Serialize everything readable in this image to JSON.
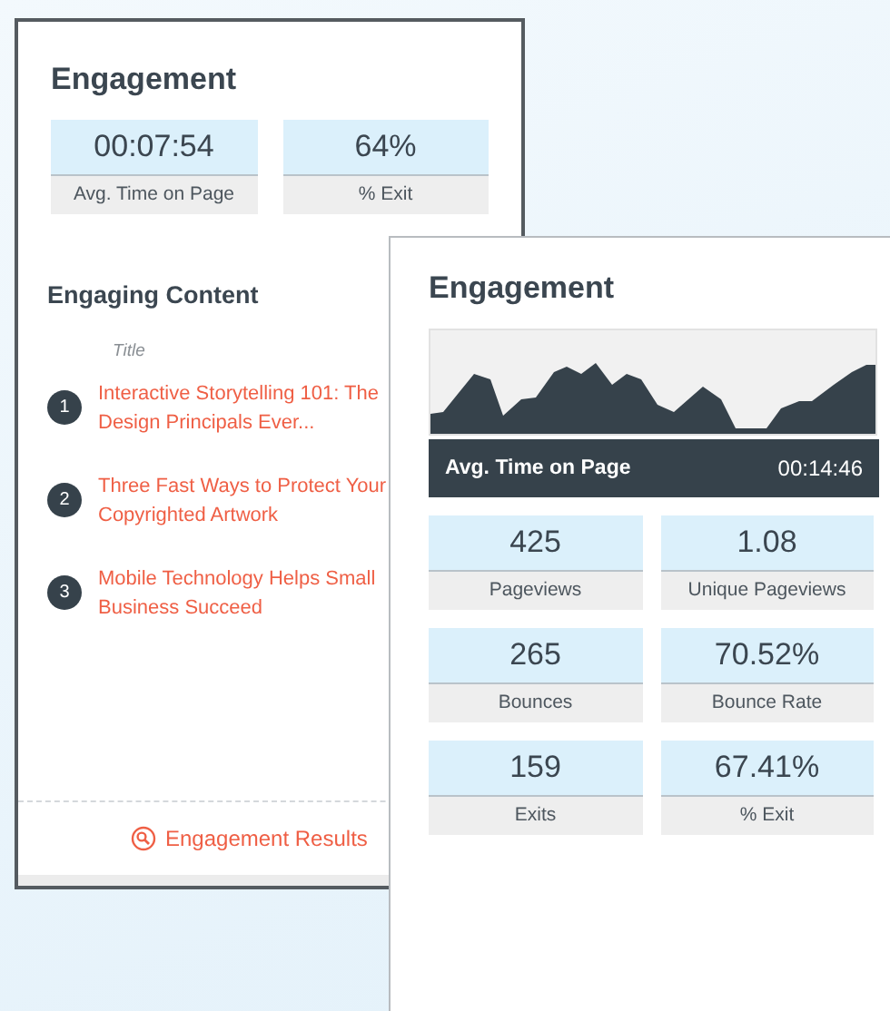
{
  "back_panel": {
    "title": "Engagement",
    "stats": [
      {
        "value": "00:07:54",
        "label": "Avg. Time on Page"
      },
      {
        "value": "64%",
        "label": "% Exit"
      }
    ],
    "content": {
      "title": "Engaging Content",
      "column_header": "Title",
      "items": [
        {
          "rank": "1",
          "title": "Interactive Storytelling 101: The Design Principals Ever..."
        },
        {
          "rank": "2",
          "title": "Three Fast Ways to Protect Your Copyrighted Artwork"
        },
        {
          "rank": "3",
          "title": "Mobile Technology Helps Small Business Succeed"
        }
      ]
    },
    "footer_link": "Engagement Results"
  },
  "front_panel": {
    "title": "Engagement",
    "chart": {
      "kind": "picture",
      "label": "Avg. Time on Page",
      "value": "00:14:46"
    },
    "stats": [
      {
        "value": "425",
        "label": "Pageviews"
      },
      {
        "value": "1.08",
        "label": "Unique Pageviews"
      },
      {
        "value": "265",
        "label": "Bounces"
      },
      {
        "value": "70.52%",
        "label": "Bounce Rate"
      },
      {
        "value": "159",
        "label": "Exits"
      },
      {
        "value": "67.41%",
        "label": "% Exit"
      }
    ]
  }
}
